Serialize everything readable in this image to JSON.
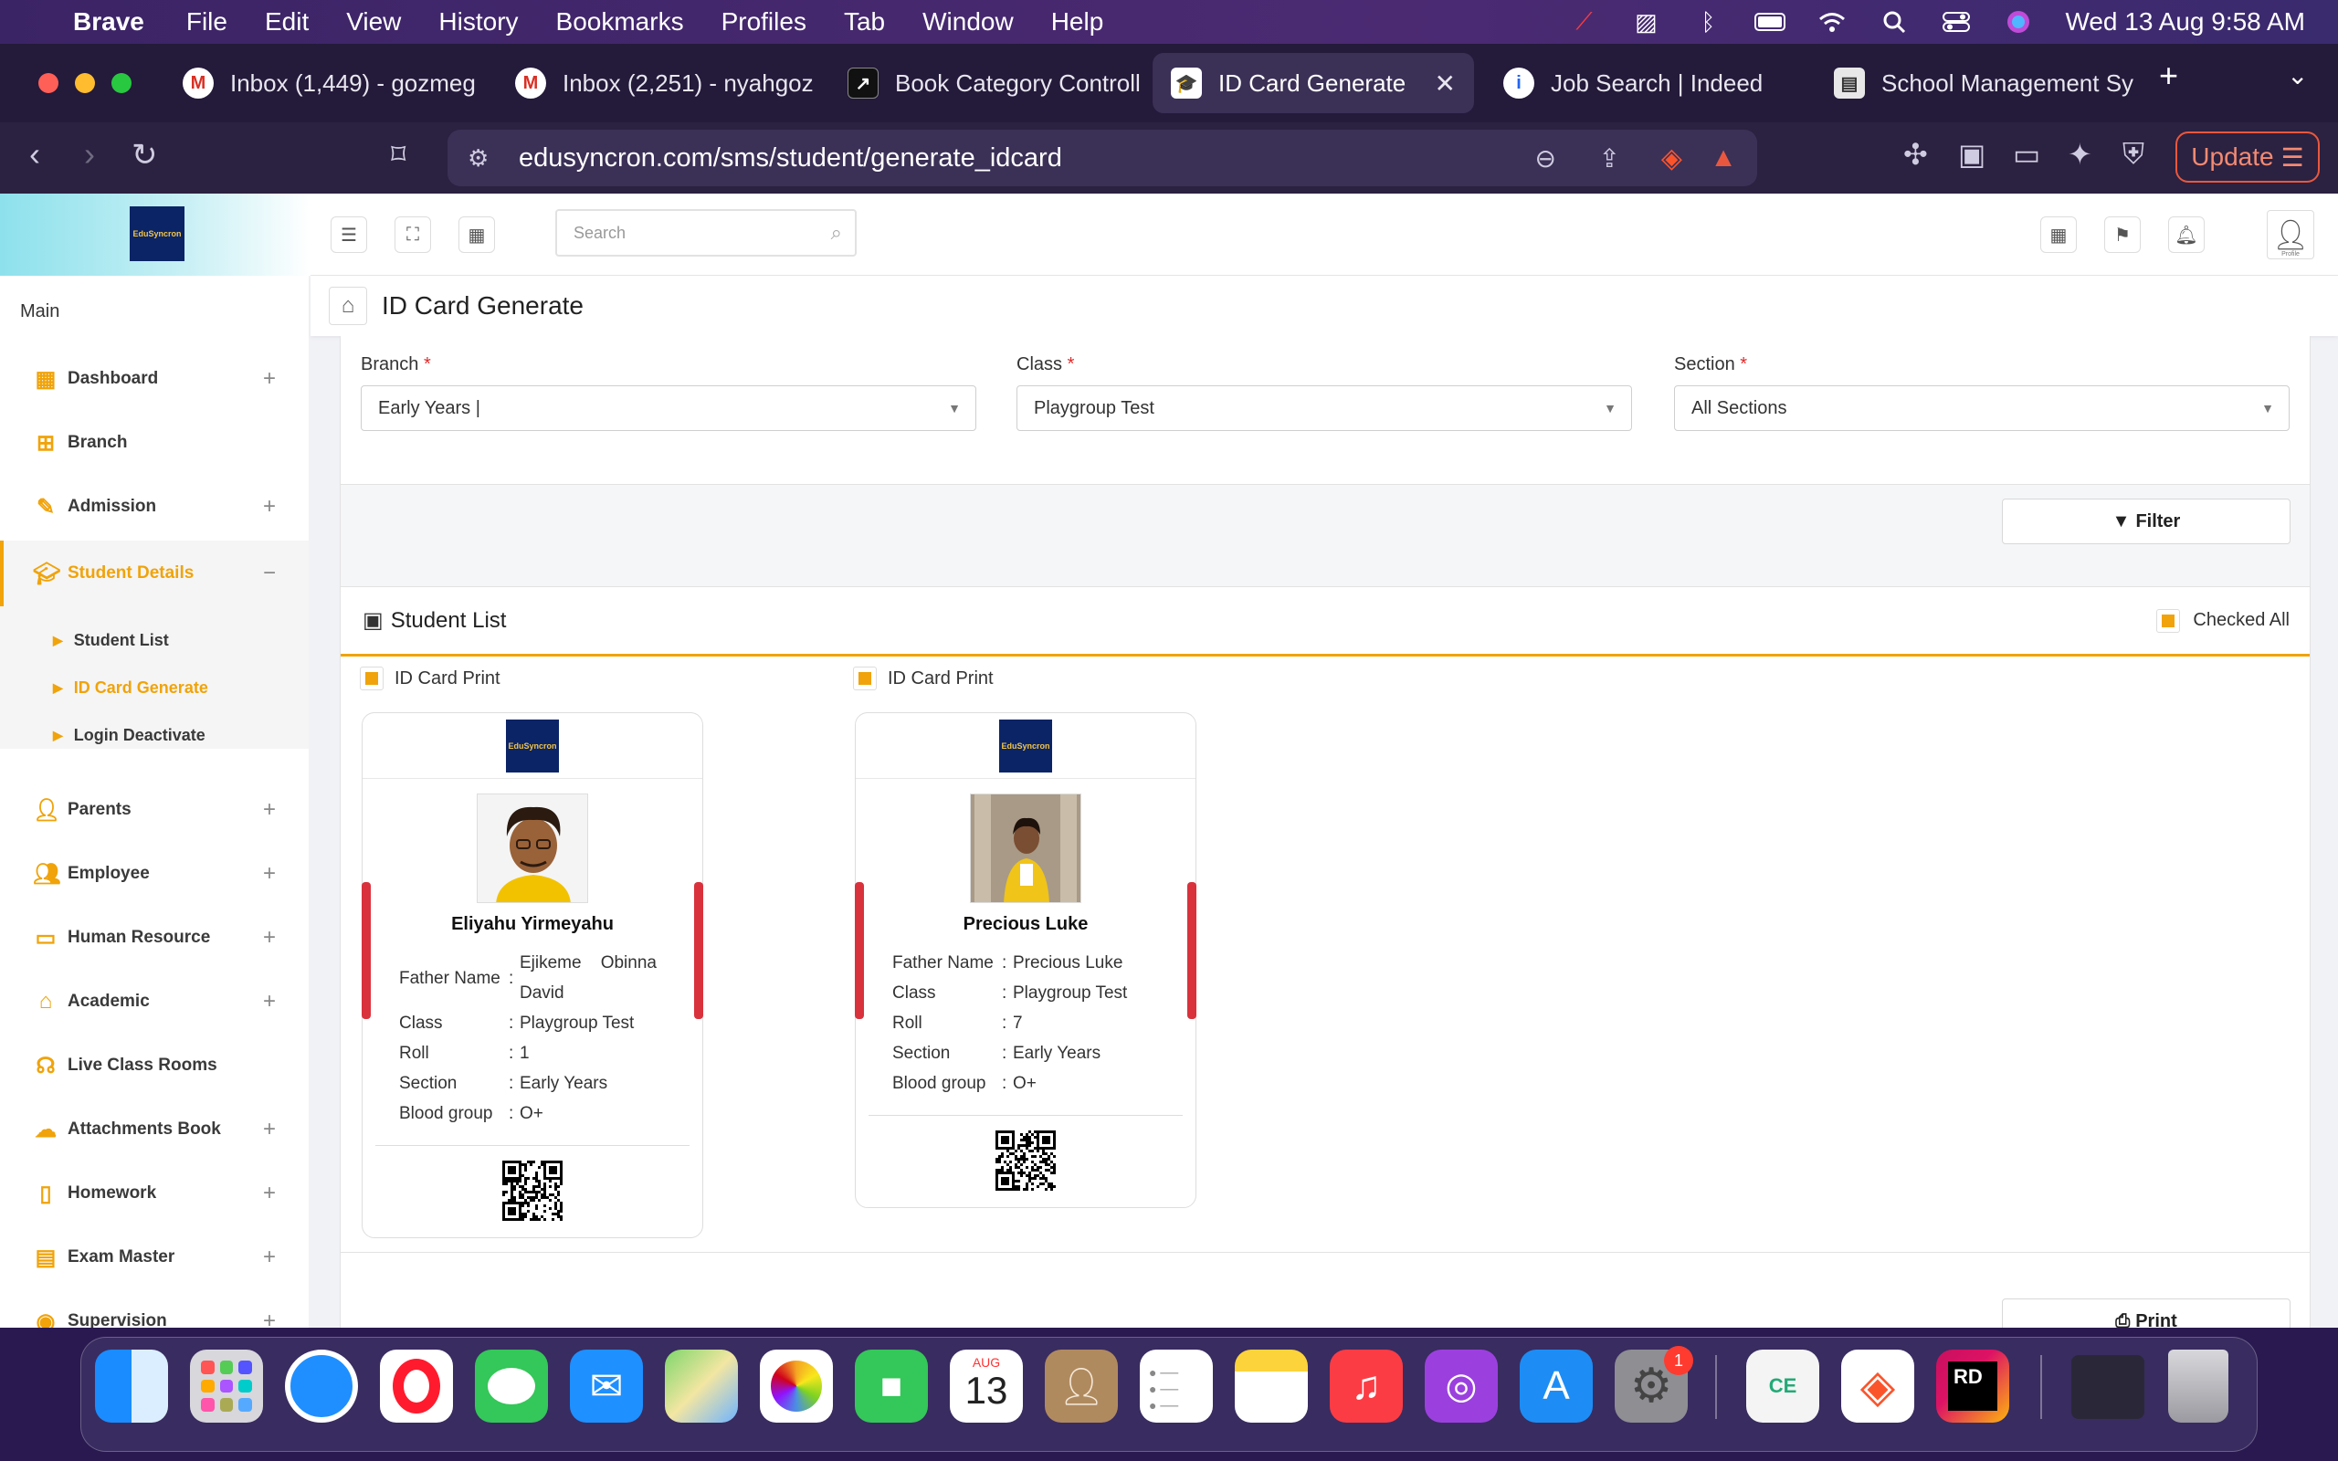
{
  "menubar": {
    "app": "Brave",
    "items": [
      "File",
      "Edit",
      "View",
      "History",
      "Bookmarks",
      "Profiles",
      "Tab",
      "Window",
      "Help"
    ],
    "clock": "Wed 13 Aug  9:58 AM"
  },
  "tabs": [
    {
      "title": "Inbox (1,449) - gozmeg",
      "icon": "gmail-icon"
    },
    {
      "title": "Inbox (2,251) - nyahgoz",
      "icon": "gmail-icon"
    },
    {
      "title": "Book Category Controll",
      "icon": "page-icon"
    },
    {
      "title": "ID Card Generate",
      "icon": "graduation-cap-icon"
    },
    {
      "title": "Job Search | Indeed",
      "icon": "indeed-icon"
    },
    {
      "title": "School Management Sy",
      "icon": "doc-icon"
    }
  ],
  "address": {
    "url": "edusyncron.com/sms/student/generate_idcard",
    "update_label": "Update"
  },
  "app": {
    "logo_text": "EduSyncron",
    "search_placeholder": "Search",
    "profile_label": "Profile",
    "page_title": "ID Card Generate",
    "sidebar": {
      "section": "Main",
      "items": [
        {
          "label": "Dashboard",
          "icon": "grid-icon",
          "expand": "+"
        },
        {
          "label": "Branch",
          "icon": "branch-icon",
          "expand": ""
        },
        {
          "label": "Admission",
          "icon": "edit-icon",
          "expand": "+"
        },
        {
          "label": "Student Details",
          "icon": "graduation-cap-icon",
          "expand": "−"
        },
        {
          "label": "Parents",
          "icon": "user-icon",
          "expand": "+"
        },
        {
          "label": "Employee",
          "icon": "users-icon",
          "expand": "+"
        },
        {
          "label": "Human Resource",
          "icon": "monitor-icon",
          "expand": "+"
        },
        {
          "label": "Academic",
          "icon": "home-icon",
          "expand": "+"
        },
        {
          "label": "Live Class Rooms",
          "icon": "headset-icon",
          "expand": ""
        },
        {
          "label": "Attachments Book",
          "icon": "cloud-upload-icon",
          "expand": "+"
        },
        {
          "label": "Homework",
          "icon": "book-icon",
          "expand": "+"
        },
        {
          "label": "Exam Master",
          "icon": "book-open-icon",
          "expand": "+"
        },
        {
          "label": "Supervision",
          "icon": "eye-icon",
          "expand": "+"
        }
      ],
      "subitems": [
        "Student List",
        "ID Card Generate",
        "Login Deactivate"
      ]
    },
    "filters": {
      "branch_label": "Branch",
      "branch_value": "Early Years |",
      "class_label": "Class",
      "class_value": "Playgroup Test",
      "section_label": "Section",
      "section_value": "All Sections",
      "required_mark": "*",
      "filter_button": "Filter"
    },
    "student_list": {
      "title": "Student List",
      "checked_all": "Checked All",
      "print_button": "Print",
      "card_checkbox_label": "ID Card Print"
    },
    "cards": [
      {
        "name": "Eliyahu Yirmeyahu",
        "fields": [
          {
            "key": "Father Name",
            "value": "Ejikeme    Obinna David"
          },
          {
            "key": "Class",
            "value": "Playgroup Test"
          },
          {
            "key": "Roll",
            "value": "1"
          },
          {
            "key": "Section",
            "value": "Early Years"
          },
          {
            "key": "Blood group",
            "value": "O+"
          }
        ]
      },
      {
        "name": "Precious Luke",
        "fields": [
          {
            "key": "Father Name",
            "value": "Precious Luke"
          },
          {
            "key": "Class",
            "value": "Playgroup Test"
          },
          {
            "key": "Roll",
            "value": "7"
          },
          {
            "key": "Section",
            "value": "Early Years"
          },
          {
            "key": "Blood group",
            "value": "O+"
          }
        ]
      }
    ]
  },
  "dock": {
    "calendar_month": "AUG",
    "calendar_day": "13",
    "settings_badge": "1",
    "apps": [
      "Finder",
      "Launchpad",
      "Safari",
      "Opera",
      "Messages",
      "Mail",
      "Maps",
      "Photos",
      "FaceTime",
      "Calendar",
      "Contacts",
      "Reminders",
      "Notes",
      "Music",
      "Podcasts",
      "App Store",
      "System Settings",
      "CE",
      "Brave",
      "Rider",
      "Screenshot",
      "Trash"
    ]
  },
  "colors": {
    "accent": "#f0a30a",
    "card_stripe": "#d9323c",
    "brave_update": "#e9583e"
  }
}
